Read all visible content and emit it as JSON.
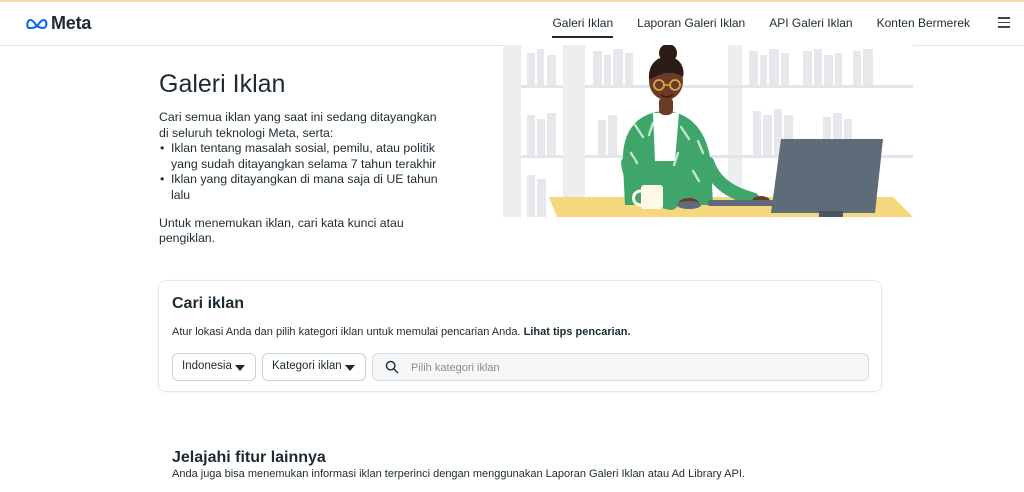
{
  "brand": {
    "logo_text": "Meta",
    "accent": "#1c2b33"
  },
  "nav": {
    "links": [
      {
        "label": "Galeri Iklan",
        "active": true
      },
      {
        "label": "Laporan Galeri Iklan",
        "active": false
      },
      {
        "label": "API Galeri Iklan",
        "active": false
      },
      {
        "label": "Konten Bermerek",
        "active": false
      }
    ],
    "menu_icon": "hamburger-icon"
  },
  "hero": {
    "title": "Galeri Iklan",
    "intro": "Cari semua iklan yang saat ini sedang ditayangkan di seluruh teknologi Meta, serta:",
    "bullets": [
      "Iklan tentang masalah sosial, pemilu, atau politik yang sudah ditayangkan selama 7 tahun terakhir",
      "Iklan yang ditayangkan di mana saja di UE tahun lalu"
    ],
    "outro": "Untuk menemukan iklan, cari kata kunci atau pengiklan."
  },
  "search_card": {
    "title": "Cari iklan",
    "description": "Atur lokasi Anda dan pilih kategori iklan untuk memulai pencarian Anda.",
    "tips_link": "Lihat tips pencarian.",
    "country_value": "Indonesia",
    "category_value": "Kategori iklan",
    "search_placeholder": "Pilih kategori iklan",
    "search_icon": "search-icon"
  },
  "explore": {
    "title": "Jelajahi fitur lainnya",
    "description": "Anda juga bisa menemukan informasi iklan terperinci dengan menggunakan Laporan Galeri Iklan atau Ad Library API."
  }
}
